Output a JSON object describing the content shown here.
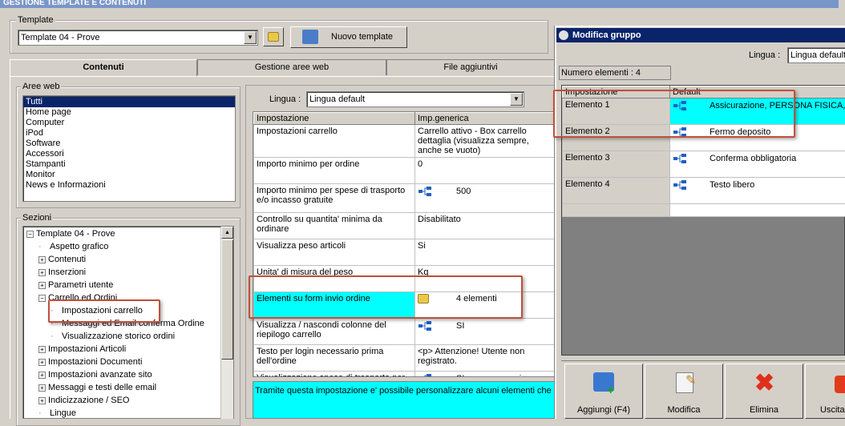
{
  "window": {
    "title": "GESTIONE TEMPLATE E CONTENUTI"
  },
  "template_group": {
    "label": "Template",
    "selected": "Template 04 - Prove",
    "new_template_label": "Nuovo template"
  },
  "tabs": [
    "Contenuti",
    "Gestione aree web",
    "File aggiuntivi"
  ],
  "aree_web": {
    "label": "Aree web",
    "items": [
      "Tutti",
      "Home page",
      "Computer",
      "iPod",
      "Software",
      "Accessori",
      "Stampanti",
      "Monitor",
      "News e Informazioni"
    ]
  },
  "sezioni": {
    "label": "Sezioni",
    "items": [
      {
        "label": "Template 04 - Prove",
        "prefix": "minus",
        "indent": 0
      },
      {
        "label": "Aspetto grafico",
        "prefix": "line",
        "indent": 1
      },
      {
        "label": "Contenuti",
        "prefix": "plus",
        "indent": 1
      },
      {
        "label": "Inserzioni",
        "prefix": "plus",
        "indent": 1
      },
      {
        "label": "Parametri utente",
        "prefix": "plus",
        "indent": 1
      },
      {
        "label": "Carrello ed Ordini",
        "prefix": "minus",
        "indent": 1
      },
      {
        "label": "Impostazioni carrello",
        "prefix": "line",
        "indent": 2
      },
      {
        "label": "Messaggi ed Email conferma Ordine",
        "prefix": "line",
        "indent": 2
      },
      {
        "label": "Visualizzazione storico ordini",
        "prefix": "line",
        "indent": 2
      },
      {
        "label": "Impostazioni Articoli",
        "prefix": "plus",
        "indent": 1
      },
      {
        "label": "Impostazioni Documenti",
        "prefix": "plus",
        "indent": 1
      },
      {
        "label": "Impostazioni avanzate sito",
        "prefix": "plus",
        "indent": 1
      },
      {
        "label": "Messaggi e testi delle email",
        "prefix": "plus",
        "indent": 1
      },
      {
        "label": "Indicizzazione / SEO",
        "prefix": "plus",
        "indent": 1
      },
      {
        "label": "Lingue",
        "prefix": "line",
        "indent": 1
      }
    ]
  },
  "settings": {
    "lingua_label": "Lingua :",
    "lingua_value": "Lingua default",
    "col_impostazione": "Impostazione",
    "col_imp_generica": "Imp.generica",
    "rows": [
      {
        "name": "Impostazioni carrello",
        "value": "Carrello attivo - Box carrello dettaglia (visualizza sempre, anche se vuoto)",
        "icon": ""
      },
      {
        "name": "Importo minimo per ordine",
        "value": "0",
        "icon": ""
      },
      {
        "name": "Importo minimo per spese di trasporto e/o incasso gratuite",
        "value": "500",
        "icon": "tree"
      },
      {
        "name": "Controllo su quantita' minima da ordinare",
        "value": "Disabilitato",
        "icon": ""
      },
      {
        "name": "Visualizza peso articoli",
        "value": "Si",
        "icon": ""
      },
      {
        "name": "Unita' di misura del peso",
        "value": "Kg",
        "icon": ""
      },
      {
        "name": "Elementi su form invio ordine",
        "value": "4 elementi",
        "icon": "folder"
      },
      {
        "name": "Visualizza / nascondi colonne del riepilogo carrello",
        "value": "SI",
        "icon": "tree"
      },
      {
        "name": "Testo per login necessario prima dell'ordine",
        "value": "<p> Attenzione! Utente non registrato.",
        "icon": ""
      },
      {
        "name": "Visualizzazione spese di trasporto per",
        "value": "SI con messaggio",
        "icon": "tree"
      }
    ],
    "description": "Tramite questa impostazione e' possibile personalizzare alcuni elementi che co"
  },
  "dialog": {
    "title": "Modifica gruppo",
    "lingua_label": "Lingua :",
    "lingua_value": "Lingua default",
    "numero_elementi": "Numero elementi : 4",
    "col_impostazione": "Impostazione",
    "col_default": "Default",
    "rows": [
      {
        "name": "Elemento 1",
        "value": "Assicurazione, PERSONA FISICA, I"
      },
      {
        "name": "Elemento 2",
        "value": "Fermo deposito"
      },
      {
        "name": "Elemento 3",
        "value": "Conferma obbligatoria"
      },
      {
        "name": "Elemento 4",
        "value": "Testo libero"
      }
    ],
    "buttons": [
      "Aggiungi (F4)",
      "Modifica",
      "Elimina",
      "Uscita"
    ]
  },
  "colors": {
    "highlight": "#00ffff",
    "selection": "#0a246a",
    "callout": "#c0503c",
    "title": "#0a246a"
  }
}
